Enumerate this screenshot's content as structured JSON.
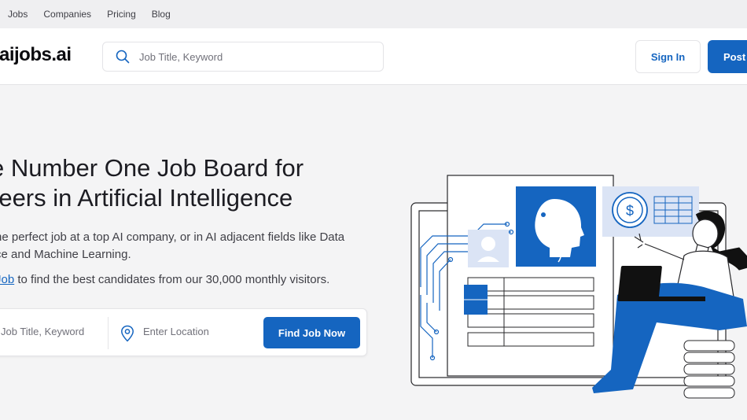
{
  "topnav": {
    "links": [
      "Jobs",
      "Companies",
      "Pricing",
      "Blog"
    ]
  },
  "header": {
    "logo": "aijobs.ai",
    "search_placeholder": "Job Title, Keyword",
    "signin_label": "Sign In",
    "post_label": "Post"
  },
  "hero": {
    "title_line1": "e Number One Job Board for",
    "title_line2": "reers in Artificial Intelligence",
    "subtitle_line1": "he perfect job at a top AI company, or in AI adjacent fields like Data",
    "subtitle_line2": "ce and Machine Learning.",
    "post_link": "Job",
    "post_text": " to find the best candidates from our 30,000 monthly visitors."
  },
  "search": {
    "keyword_placeholder": "Job Title, Keyword",
    "location_placeholder": "Enter Location",
    "button_label": "Find Job Now"
  },
  "icons": {
    "search": "search-icon",
    "location": "location-pin-icon",
    "dollar": "dollar-icon"
  },
  "colors": {
    "brand": "#1565c0",
    "background": "#f4f4f5",
    "text": "#18181b"
  }
}
